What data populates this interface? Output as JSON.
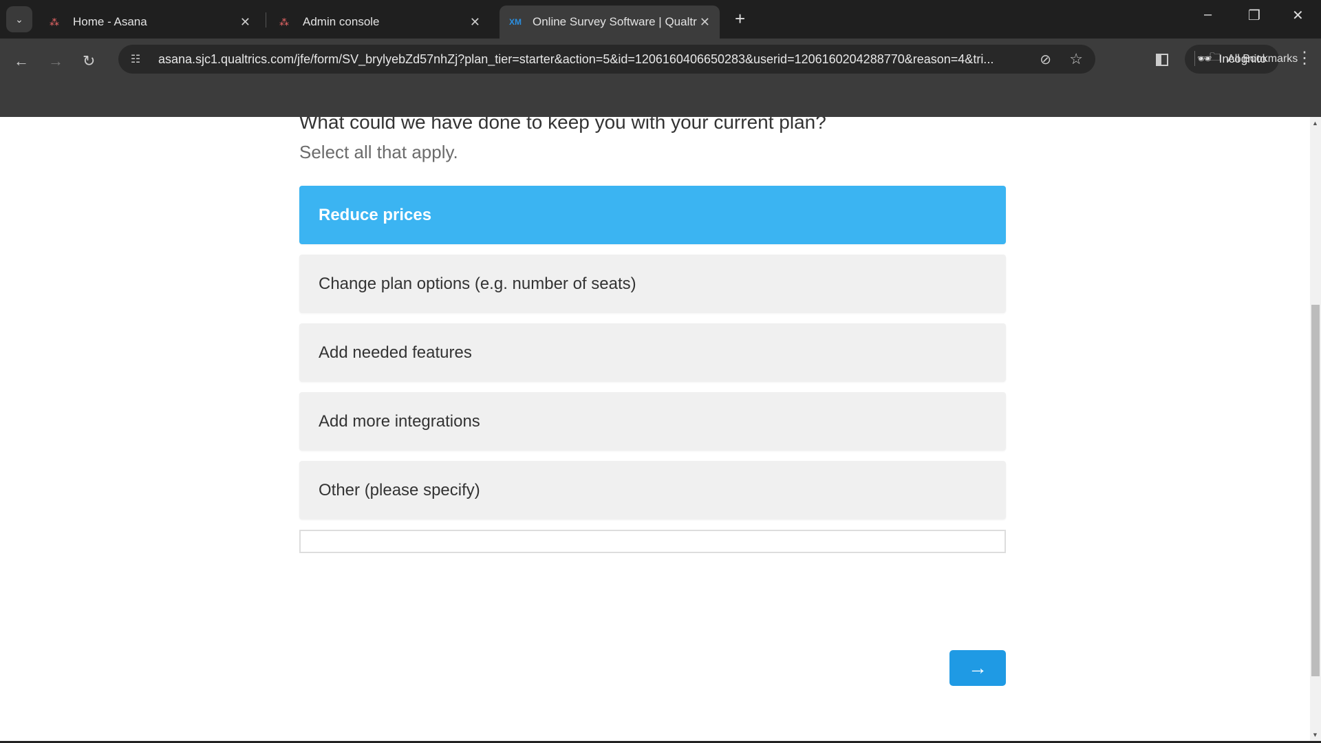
{
  "browser": {
    "tabs": [
      {
        "title": "Home - Asana",
        "icon": "asana-icon",
        "active": false
      },
      {
        "title": "Admin console",
        "icon": "asana-icon",
        "active": false
      },
      {
        "title": "Online Survey Software | Qualtr",
        "icon": "qualtrics-xm-icon",
        "active": true
      }
    ],
    "url": "asana.sjc1.qualtrics.com/jfe/form/SV_brylyebZd57nhZj?plan_tier=starter&action=5&id=1206160406650283&userid=1206160204288770&reason=4&tri...",
    "incognito_label": "Incognito",
    "bookmarks_label": "All Bookmarks"
  },
  "survey": {
    "question": "What could we have done to keep you with your current plan?",
    "instruction": "Select all that apply.",
    "options": [
      {
        "label": "Reduce prices",
        "selected": true
      },
      {
        "label": "Change plan options (e.g. number of seats)",
        "selected": false
      },
      {
        "label": "Add needed features",
        "selected": false
      },
      {
        "label": "Add more integrations",
        "selected": false
      },
      {
        "label": "Other (please specify)",
        "selected": false
      }
    ],
    "other_text": "",
    "next_label": "→"
  },
  "colors": {
    "selected": "#3bb4f2",
    "button": "#1f9ae4",
    "option_bg": "#f0f0f0"
  }
}
